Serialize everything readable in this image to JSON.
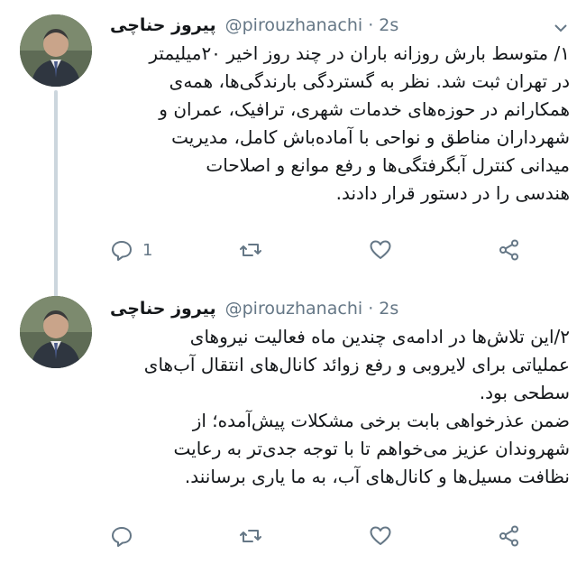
{
  "tweets": [
    {
      "display_name": "پیروز حناچی",
      "handle": "@pirouzhanachi",
      "separator": "·",
      "time": "2s",
      "lines": [
        "۱/ متوسط بارش روزانه باران در چند روز اخیر ۲۰میلیمتر",
        "در تهران ثبت شد. نظر به گستردگی بارندگی‌ها، همه‌ی",
        "همکارانم در حوزه‌های خدمات شهری، ترافیک، عمران و",
        "شهرداران مناطق و نواحی با آماده‌باش کامل، مدیریت",
        "میدانی کنترل آبگرفتگی‌ها و رفع موانع و اصلاحات",
        "هندسی را در دستور قرار دادند."
      ],
      "reply_count": "1",
      "retweet_count": "",
      "like_count": ""
    },
    {
      "display_name": "پیروز حناچی",
      "handle": "@pirouzhanachi",
      "separator": "·",
      "time": "2s",
      "lines": [
        "۲/این تلاش‌ها در ادامه‌ی چندین ماه فعالیت نیروهای",
        "عملیاتی برای لایروبی و رفع زوائد کانال‌های انتقال آب‌های",
        "سطحی بود.",
        "ضمن عذرخواهی بابت برخی مشکلات پیش‌آمده؛ از",
        "شهروندان عزیز می‌خواهم تا با توجه جدی‌تر به رعایت",
        "نظافت مسیل‌ها و کانال‌های آب، به ما یاری برسانند."
      ],
      "reply_count": "",
      "retweet_count": "",
      "like_count": ""
    }
  ],
  "icons": {
    "reply": "reply-icon",
    "retweet": "retweet-icon",
    "like": "heart-icon",
    "share": "share-icon",
    "menu": "chevron-down-icon"
  },
  "colors": {
    "text": "#14171a",
    "secondary": "#657786",
    "thread_line": "#ccd6dd"
  }
}
